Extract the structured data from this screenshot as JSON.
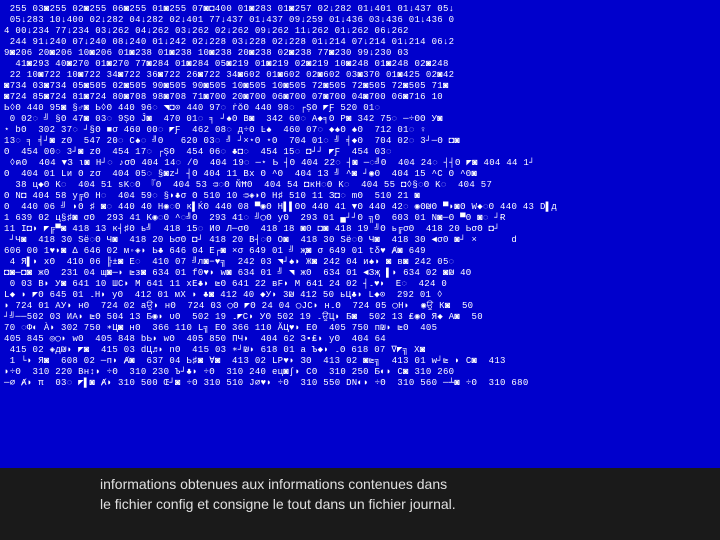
{
  "caption_line1": "informations obtenues aux informations contenues dans",
  "caption_line2": "le fichier config et consigne le tout dans un fichier journal.",
  "hex_lines": [
    " 255 03◙255 02◙255 06◙255 01◙255 07◙◘400 01◙283 01◙257 02↓282 01↓401 01↓437 05↓",
    " 05↓283 10↓400 02↓282 04↓282 02↓401 77↓437 01↓437 09↓259 01↓436 03↓436 01↓436 0",
    "4 00↓234 77↓234 03↓262 04↓262 03↓262 02↓262 09↓262 11↓262 01↓262 06↓262 ",
    " 244 91↓240 07↓240 08↓240 01↓242 02↓228 03↓228 02↓228 01↓214 07↓214 01↓214 06↓2",
    "9◙206 20◙206 10◙206 01◙238 01◙238 10◙238 20◙238 02◙238 77◙230 99↓230 03 ",
    "  41◙293 40◙270 01◙270 77◙284 01◙284 05◙219 01◙219 02◙219 10◙248 01◙248 02◙248 ",
    " 22 10◙722 10◙722 34◙722 36◙722 26◙722 34◙602 01◙602 02◙602 03◙370 01◙425 02◙42",
    "◙734 03◙734 05◙505 02◙505 90◙505 90◙505 10◙505 10◙505 72◙505 72◙505 72◙505 71◙ ",
    "◙724 85◙724 81◙724 80◙708 98◙708 71◙700 20◙700 06◙700 07◙700 04◙700 06◙716 10  ",
    "Ь◊Θ 440 95◙ §♂◙ Ь◊Θ 440 96◌ ◥◘⊙ 440 97◌ ṙǒΘ 440 98◌ ┌ȘΘ ◤Ƒ 520 01◌ ",
    " 0 02◌ ╝ §Θ 47◙ 03◌ 9ȘΘ Ĵ◙  470 01◌ ╕ ┘♠Θ B◙  342 60◌ A◆╕Θ P◙ 342 75◌ ─÷ΘΘ У◙ ",
    "⋆ bΘ  302 37◌ ┘§Θ ■σ 460 00◌ ◤Ƒ  462 08◌ д÷Θ Ŀ♠  460 07◌ ◆♠Θ ♠Θ  712 01◌ ♀",
    "13◌ ╕ ╡┘◙ zΘ  547 20◌ C♠◌ ╝Θ   620 03◌ ╝ ┘×⋆Θ ⋆Θ  704 01◌ ╝ ╡◆Θ  704 02◌ 3┘─Θ ◘◙",
    "Θ  454 00◌ 3┘◙ zΘ  454 17◌ ┌ȘΘ  454 06◌ ♣◘◌  454 15◌ ◘┘┘ ◤Ƒ  454 03◌",
    " ◊ฅΘ  404 ▼З ɩ◙ H┘◌ ♪σΘ 404 14◌ /Θ  404 19◌ ─⋆ Ь ┤Θ 404 22◌ ┤◙ ─◌╝Θ  404 24◌ ┤┤Θ ◤◙ 404 44 1┘",
    "Θ  404 01 Lи Θ zσ  404 05◌ §◙z┘ ┤Θ 404 11 Bx Θ ^Θ  404 13 ╝ ^◙ ┘◉Θ  404 15 ^C Θ ^Θ◙",
    "  38 ц◆Θ K◌  404 51 sK◌Θ 『Θ  404 53 ᴞ◌Θ ŇĦΘ  404 54 ◘кH◌Θ K◌  404 55 ◘◊§◌Θ K◌  404 57",
    "Θ N◘ 404 58 y╔Θ H◌  404 59◌ §◗♣σ Θ 510 10 ᴞ◈◗Θ Н♯ 510 11 З◘◌ mΘ  510 21 ◙",
    "Θ  440 06 ╝ ◗Θ ♯ ◙◌ 440 40 H◉◌Θ к▌ЌΘ 440 08 ▀◉Θ H▌▌ΘΘ 440 41 ▼Θ 440 42◌ ◉Θ₪Θ ▀◗◙Θ W◆◌Θ 440 43 D▌д",
    "1 639 02 ц§♯◙ σΘ  293 41 K◉◌Θ ^◌╝Θ  293 41◌ ╝◯Θ yΘ  293 01 ▄┘┘Θ ╗Θ  603 01 N◙─Θ ▀Θ ◙◌ ┘Ɍ",
    "11 I◘◗ ◤╔▀◙ 418 13 к┤♯Θ ь╝  418 15◌ ИΘ Л─σΘ  418 18 ◙Θ ◘◙ 418 19 ╝Θ ь╔σΘ  418 20 ЬσΘ ◘┘",
    " ┘Ч◙  418 30 Sё◌Θ Ч◙  418 20 ЬσΘ ◘┘ 418 20 В┤◌Θ О◙  418 30 Sё◌Θ Ч◙  418 30 ◄σΘ ◙┘ ×      d",
    "606 00 1♥◗◙ Δ 646 02 м◦◈◗ Ь♣ 646 04 E┌◙ ×σ 649 01 ╝ җ◙ σ 649 01 tδ♥ Ⱥ◙ 649",
    " 4 Я▌◗ xΘ  410 06 ╠±◙ E◌  410 07 ╝л◙−♥╗  242 03 ◥┘♠◗ Ж◙ 242 04 и♠◗ ◙ в◙ 242 05◌",
    "◘◙─◘◙ жΘ  231 04 щ◙─◗ ⊵з◙ 634 01 f0♥◗ w◙ 634 01 ╝ ◥ жΘ  634 01 ◄Зҗ ▌◗ 634 02 ◙₪ 4Θ  ",
    " 0 03 В◗ У◙ 641 10 ШС◗ М 641 11 хЕ♣◗ ⊵Θ 641 22 вF◗ М 641 24 02 ┤۔♥◗  E◌  424 0",
    "L◆ ◗ ◤Θ 645 01 ۔Н◗ уΘ  412 01 мХ ◗ ♣◙ 412 40 ◆У◗ 3₪ 412 50 ьЦ♣◗ L◆⊙  292 01 ◊",
    "◗ 724 01 АУ◗ нΘ  724 02 аਉ◗ нΘ  724 03 ◯Θ ◤Θ 24 04 ◯JC◗ н۔Θ  724 05 ◯Н◗  ◉ਉ К◙  50",
    "┘╝──502 03 ИА◗ ⊵Θ 504 13 Б◉◗ υΘ  502 19 ۔◤C◗ УΘ 502 19 ۔ਉЦ◗ Б◙  502 13 ₤◉Θ Я◆ А◙  50",
    "70 ◌Φ◐ À◗ 302 750 ∗Ц◙ нΘ  366 110 L╗ ЕΘ 366 110 ĂЦ♥◗ ЕΘ  405 750 п₪◗ ⊵Θ  405",
    "405 845 ◎◯◗ wΘ  405 848 bЬ◗ wΘ  405 850 ΠЧ◗  404 62 З▪₤◗ yΘ  404 64 ",
    " 415 02 ◈д₪◗ ◤◙  415 03 dЦ♬◗ nΘ  415 03 ∗┘₪◗ 618 01 a Ъ◆◗ ۔Θ 618 07 ∇◤╗ Χ◙ ",
    " 1 └◗ Я◙  608 02 ─п◗ Ⱥ◙  637 04 Ь♯◙ Ɐ◙  413 02 LР♥◗ ЗΘ  413 02 ◙⊵╗  413 01 w┘⊵ ◗ С◙  413 ",
    "◗÷Θ  310 220 Вн↕◗ ÷Θ  310 230 Ъ┘♣◗ ÷Θ  310 240 ец◙∫◗ CΘ  310 250 Б◐◗ С◙ 310 260  ",
    "─∅ Ⱥ◗ π  03◌ ◤▌◙ Ⱥ◗ 310 500 Œ┘◙ ÷Θ 310 510 J∅♥◗ ÷Θ  310 550 DN◐◗ ÷Θ  310 560 ─┴◙ ÷Θ  310 680  "
  ]
}
